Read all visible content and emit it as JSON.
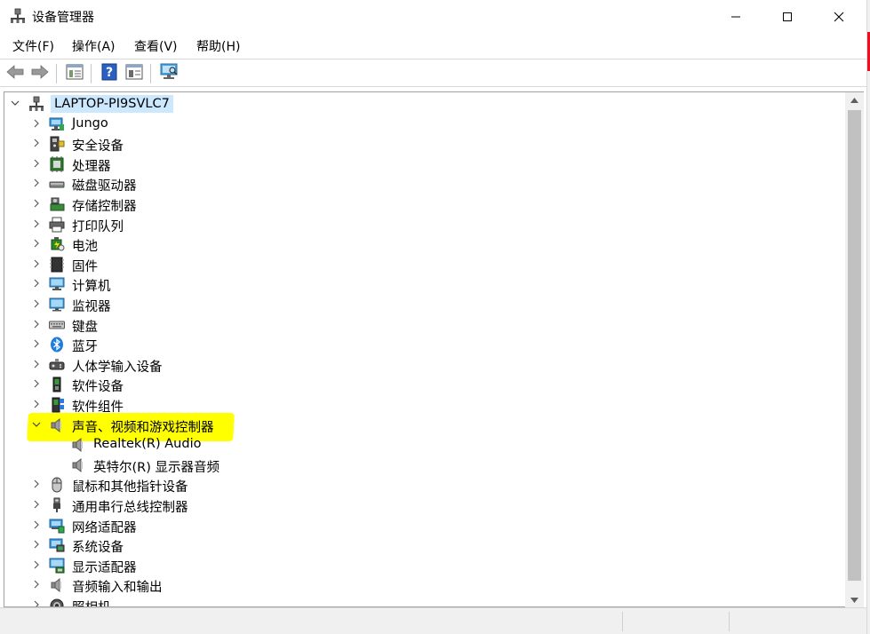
{
  "window": {
    "title": "设备管理器"
  },
  "menu": {
    "items": [
      {
        "label": "文件(F)"
      },
      {
        "label": "操作(A)"
      },
      {
        "label": "查看(V)"
      },
      {
        "label": "帮助(H)"
      }
    ]
  },
  "toolbar": {
    "buttons": [
      "back-arrow-icon",
      "forward-arrow-icon",
      "properties-icon",
      "help-icon",
      "update-driver-icon",
      "scan-hardware-icon"
    ]
  },
  "tree": {
    "root": {
      "label": "LAPTOP-PI9SVLC7",
      "expanded": true
    },
    "items": [
      {
        "label": "Jungo",
        "icon": "network-device-icon"
      },
      {
        "label": "安全设备",
        "icon": "security-device-icon"
      },
      {
        "label": "处理器",
        "icon": "processor-icon"
      },
      {
        "label": "磁盘驱动器",
        "icon": "disk-drive-icon"
      },
      {
        "label": "存储控制器",
        "icon": "storage-controller-icon"
      },
      {
        "label": "打印队列",
        "icon": "printer-icon"
      },
      {
        "label": "电池",
        "icon": "battery-icon"
      },
      {
        "label": "固件",
        "icon": "firmware-icon"
      },
      {
        "label": "计算机",
        "icon": "computer-icon"
      },
      {
        "label": "监视器",
        "icon": "monitor-icon"
      },
      {
        "label": "键盘",
        "icon": "keyboard-icon"
      },
      {
        "label": "蓝牙",
        "icon": "bluetooth-icon"
      },
      {
        "label": "人体学输入设备",
        "icon": "hid-icon"
      },
      {
        "label": "软件设备",
        "icon": "software-device-icon"
      },
      {
        "label": "软件组件",
        "icon": "software-component-icon"
      },
      {
        "label": "声音、视频和游戏控制器",
        "icon": "speaker-icon",
        "expanded": true
      },
      {
        "label": "Realtek(R) Audio",
        "icon": "speaker-icon",
        "child": true
      },
      {
        "label": "英特尔(R) 显示器音频",
        "icon": "speaker-icon",
        "child": true
      },
      {
        "label": "鼠标和其他指针设备",
        "icon": "mouse-icon"
      },
      {
        "label": "通用串行总线控制器",
        "icon": "usb-icon"
      },
      {
        "label": "网络适配器",
        "icon": "network-adapter-icon"
      },
      {
        "label": "系统设备",
        "icon": "system-device-icon"
      },
      {
        "label": "显示适配器",
        "icon": "display-adapter-icon"
      },
      {
        "label": "音频输入和输出",
        "icon": "audio-io-icon"
      },
      {
        "label": "照相机",
        "icon": "camera-icon"
      }
    ]
  },
  "colors": {
    "selection": "#cce8ff",
    "highlight": "#ffff00",
    "chevron": "#5a5a5a"
  }
}
